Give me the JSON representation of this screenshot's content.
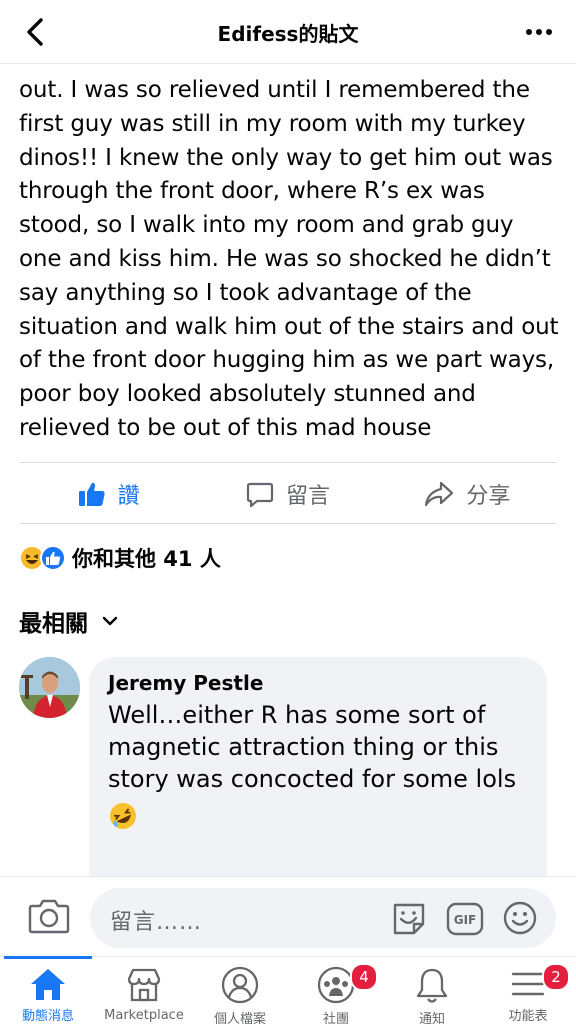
{
  "header": {
    "title": "Edifess的貼文"
  },
  "post": {
    "body_text": "out. I was so relieved until I remembered the first guy was still in my room with my turkey dinos!! I knew the only way to get him out was through the front door, where R’s ex was stood, so I walk into my room and grab guy one and kiss him. He was so shocked he didn’t say anything so I took advantage of the situation and walk him out of the stairs and out of the front door hugging him as we part ways, poor boy looked absolutely stunned and relieved to be out of this mad house"
  },
  "actions": {
    "like_label": "讚",
    "comment_label": "留言",
    "share_label": "分享"
  },
  "reactions": {
    "summary": "你和其他 41 人"
  },
  "comments": {
    "sort_label": "最相關",
    "items": [
      {
        "author": "Jeremy Pestle",
        "text": "Well…either R has some sort of magnetic attraction thing or this story was concocted for some lols"
      }
    ]
  },
  "composer": {
    "placeholder": "留言……"
  },
  "tabbar": {
    "items": [
      {
        "label": "動態消息",
        "icon": "home-icon",
        "active": true
      },
      {
        "label": "Marketplace",
        "icon": "marketplace-icon"
      },
      {
        "label": "個人檔案",
        "icon": "profile-icon"
      },
      {
        "label": "社團",
        "icon": "groups-icon",
        "badge": "4"
      },
      {
        "label": "通知",
        "icon": "bell-icon"
      },
      {
        "label": "功能表",
        "icon": "menu-icon",
        "badge": "2"
      }
    ]
  },
  "colors": {
    "accent": "#1877f2",
    "badge": "#e41e3f",
    "muted_text": "#65676b",
    "bubble": "#f0f2f5"
  }
}
